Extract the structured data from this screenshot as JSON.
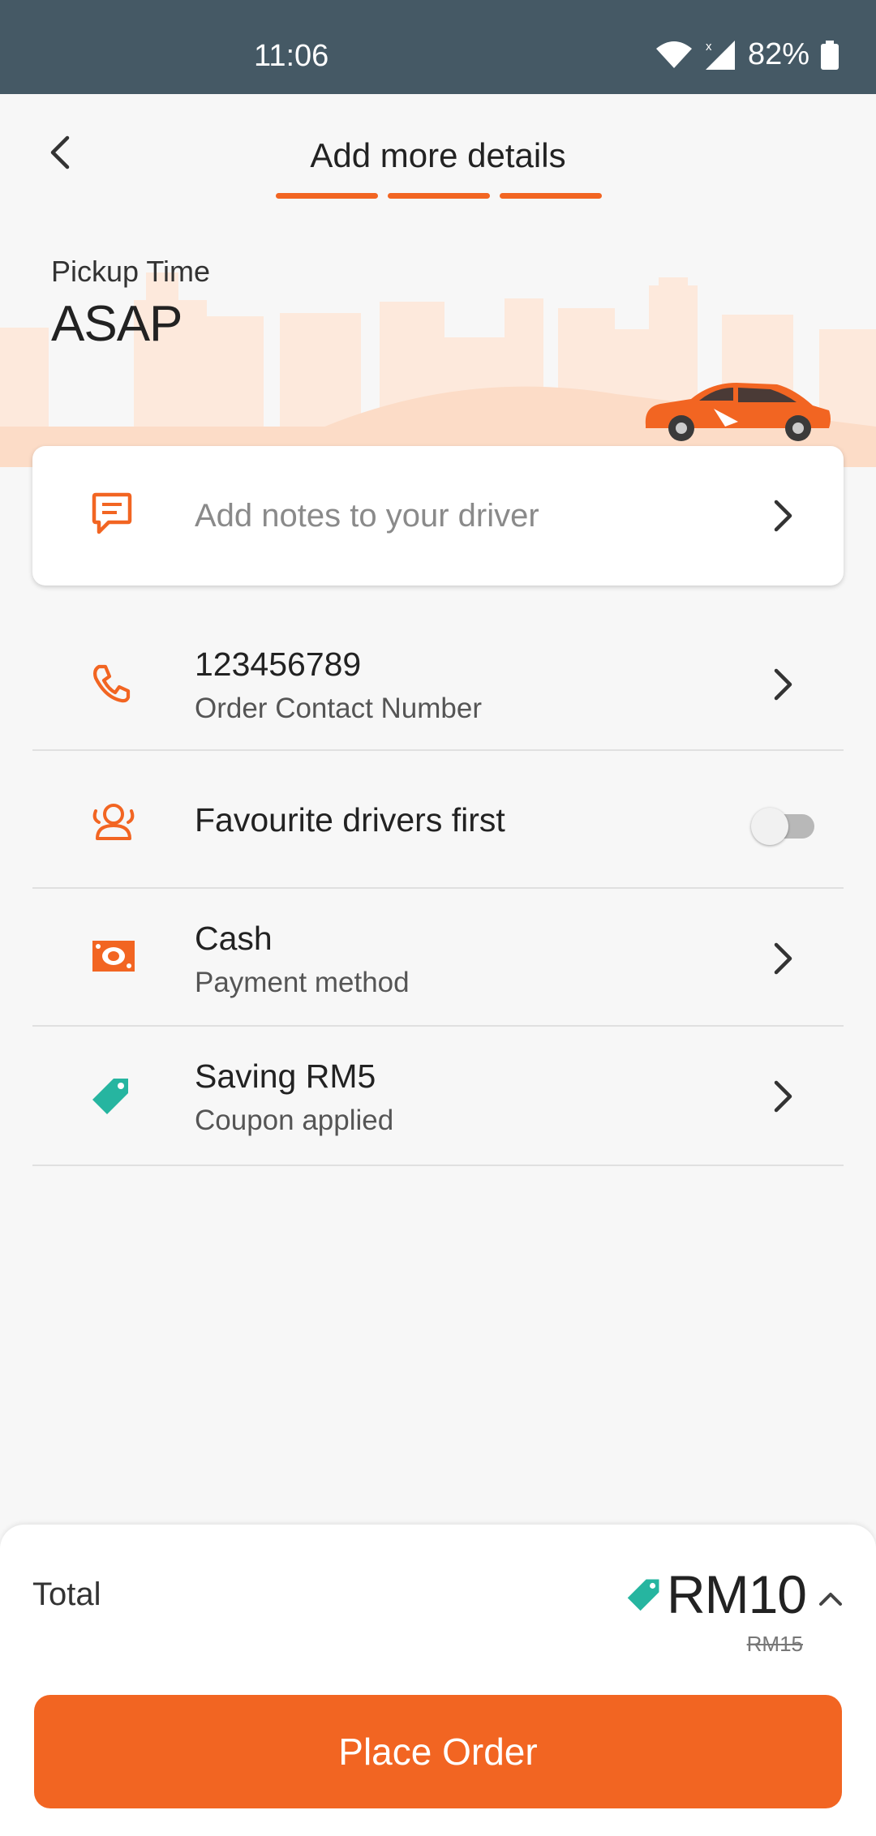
{
  "status_bar": {
    "time": "11:06",
    "battery": "82%",
    "icons": [
      "wifi-icon",
      "signal-icon",
      "battery-icon"
    ]
  },
  "header": {
    "title": "Add more details",
    "progress_steps": 3,
    "progress_completed": 3
  },
  "pickup": {
    "label": "Pickup Time",
    "value": "ASAP"
  },
  "notes": {
    "placeholder": "Add notes to your driver",
    "icon": "message-icon"
  },
  "contact": {
    "number": "123456789",
    "label": "Order Contact Number",
    "icon": "phone-icon"
  },
  "favourite_drivers": {
    "label": "Favourite drivers first",
    "enabled": false,
    "icon": "drivers-icon"
  },
  "payment": {
    "method": "Cash",
    "label": "Payment method",
    "icon": "cash-icon"
  },
  "coupon": {
    "title": "Saving RM5",
    "label": "Coupon applied",
    "icon": "tag-icon"
  },
  "total": {
    "label": "Total",
    "amount": "RM10",
    "original": "RM15"
  },
  "cta": {
    "label": "Place Order"
  },
  "colors": {
    "accent": "#f26522",
    "coupon": "#26b5a0",
    "status_bar": "#455965"
  }
}
